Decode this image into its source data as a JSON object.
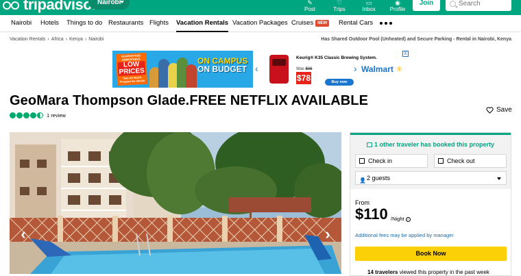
{
  "header": {
    "logo_text": "tripadvisor",
    "location": "Nairobi",
    "nav": [
      {
        "label": "Post",
        "icon": "post-icon"
      },
      {
        "label": "Trips",
        "icon": "heart-icon"
      },
      {
        "label": "Inbox",
        "icon": "chat-icon"
      },
      {
        "label": "Profile",
        "icon": "profile-icon"
      }
    ],
    "join_label": "Join",
    "search_placeholder": "Search"
  },
  "categories": [
    {
      "label": "Nairobi"
    },
    {
      "label": "Hotels"
    },
    {
      "label": "Things to do"
    },
    {
      "label": "Restaurants"
    },
    {
      "label": "Flights"
    },
    {
      "label": "Vacation Rentals",
      "active": true
    },
    {
      "label": "Vacation Packages"
    },
    {
      "label": "Cruises",
      "badge": "NEW"
    },
    {
      "label": "Rental Cars"
    }
  ],
  "breadcrumb": [
    "Vacation Rentals",
    "Africa",
    "Kenya",
    "Nairobi"
  ],
  "breadcrumb_right": "Has Shared Outdoor Pool (Unheated) and Secure Parking - Rental in Nairobi, Kenya",
  "ad": {
    "badge_top": "GUARANTEED UNBEATABLE",
    "badge_main": "LOW PRICES",
    "badge_bottom": "*See Ad Match Program for details",
    "slogan_line1": "ON CAMPUS",
    "slogan_line2": "ON BUDGET",
    "product": "Keurig® K35 Classic Brewing System.",
    "was_label": "Was",
    "was_price": "$98",
    "price": "$78",
    "buy_label": "Buy now",
    "brand": "Walmart",
    "close": "X"
  },
  "listing": {
    "title": "GeoMara Thompson Glade.FREE NETFLIX AVAILABLE",
    "rating": 4.5,
    "review_count": "1 review",
    "save_label": "Save"
  },
  "booking": {
    "booked_msg": "1 other traveler has booked this property",
    "check_in": "Check in",
    "check_out": "Check out",
    "guests": "2 guests",
    "from_label": "From",
    "price": "$110",
    "per_night": "/Night",
    "fees_note": "Additional fees may be applied by manager",
    "book_label": "Book Now",
    "viewed_count": "14 travelers",
    "viewed_text": " viewed this property in the past week"
  },
  "colors": {
    "brand_green": "#00a680",
    "rating_green": "#00aa6c",
    "book_yellow": "#fcd006",
    "link_blue": "#1a6aa8"
  }
}
